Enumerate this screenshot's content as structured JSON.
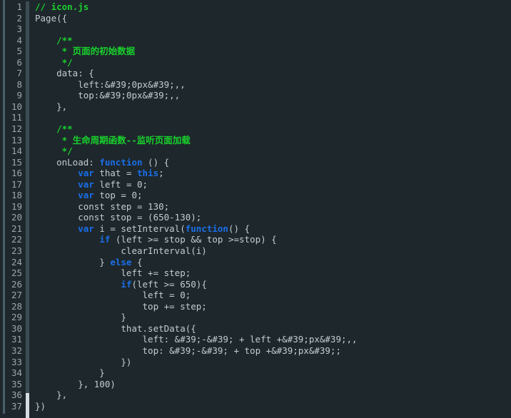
{
  "editor": {
    "language": "javascript",
    "filename": "icon.js",
    "theme": {
      "background": "#1e272c",
      "gutter_background": "#1e272c",
      "line_number_color": "#9aa7ad",
      "default_text": "#c3ccd1",
      "comment": "#19d12c",
      "keyword": "#1a6fe8",
      "string": "#22d3d3",
      "separator": "#3c4c53",
      "separator_highlight": "#d6dde0",
      "rail": "#4a6068"
    },
    "first_line_number": 1,
    "last_line_number": 37,
    "total_lines": 37,
    "lines": [
      {
        "n": "1",
        "tokens": [
          {
            "t": "// icon.js",
            "c": "comment"
          }
        ]
      },
      {
        "n": "2",
        "tokens": [
          {
            "t": "Page({",
            "c": "plain"
          }
        ]
      },
      {
        "n": "3",
        "tokens": [
          {
            "t": "",
            "c": "plain"
          }
        ]
      },
      {
        "n": "4",
        "tokens": [
          {
            "t": "    /**",
            "c": "comment"
          }
        ]
      },
      {
        "n": "5",
        "tokens": [
          {
            "t": "     * 页面的初始数据",
            "c": "comment"
          }
        ]
      },
      {
        "n": "6",
        "tokens": [
          {
            "t": "     */",
            "c": "comment"
          }
        ]
      },
      {
        "n": "7",
        "tokens": [
          {
            "t": "    data: {",
            "c": "plain"
          }
        ]
      },
      {
        "n": "8",
        "tokens": [
          {
            "t": "        left:",
            "c": "plain"
          },
          {
            "t": "&#39;0px&#39;,",
            "c": "string"
          },
          {
            "t": ",",
            "c": "string"
          }
        ]
      },
      {
        "n": "9",
        "tokens": [
          {
            "t": "        top:",
            "c": "plain"
          },
          {
            "t": "&#39;0px&#39;,",
            "c": "string"
          },
          {
            "t": ",",
            "c": "string"
          }
        ]
      },
      {
        "n": "10",
        "tokens": [
          {
            "t": "    },",
            "c": "plain"
          }
        ]
      },
      {
        "n": "11",
        "tokens": [
          {
            "t": "",
            "c": "plain"
          }
        ]
      },
      {
        "n": "12",
        "tokens": [
          {
            "t": "    /**",
            "c": "comment"
          }
        ]
      },
      {
        "n": "13",
        "tokens": [
          {
            "t": "     * 生命周期函数--监听页面加载",
            "c": "comment"
          }
        ]
      },
      {
        "n": "14",
        "tokens": [
          {
            "t": "     */",
            "c": "comment"
          }
        ]
      },
      {
        "n": "15",
        "tokens": [
          {
            "t": "    onLoad: ",
            "c": "plain"
          },
          {
            "t": "function",
            "c": "kw"
          },
          {
            "t": " () {",
            "c": "plain"
          }
        ]
      },
      {
        "n": "16",
        "tokens": [
          {
            "t": "        ",
            "c": "plain"
          },
          {
            "t": "var",
            "c": "kw"
          },
          {
            "t": " that = ",
            "c": "plain"
          },
          {
            "t": "this",
            "c": "kw"
          },
          {
            "t": ";",
            "c": "plain"
          }
        ]
      },
      {
        "n": "17",
        "tokens": [
          {
            "t": "        ",
            "c": "plain"
          },
          {
            "t": "var",
            "c": "kw"
          },
          {
            "t": " left = 0;",
            "c": "plain"
          }
        ]
      },
      {
        "n": "18",
        "tokens": [
          {
            "t": "        ",
            "c": "plain"
          },
          {
            "t": "var",
            "c": "kw"
          },
          {
            "t": " top = 0;",
            "c": "plain"
          }
        ]
      },
      {
        "n": "19",
        "tokens": [
          {
            "t": "        const step = 130;",
            "c": "plain"
          }
        ]
      },
      {
        "n": "20",
        "tokens": [
          {
            "t": "        const stop = (650-130);",
            "c": "plain"
          }
        ]
      },
      {
        "n": "21",
        "tokens": [
          {
            "t": "        ",
            "c": "plain"
          },
          {
            "t": "var",
            "c": "kw"
          },
          {
            "t": " i = setInterval(",
            "c": "plain"
          },
          {
            "t": "function",
            "c": "kw"
          },
          {
            "t": "() {",
            "c": "plain"
          }
        ]
      },
      {
        "n": "22",
        "tokens": [
          {
            "t": "            ",
            "c": "plain"
          },
          {
            "t": "if",
            "c": "kw"
          },
          {
            "t": " (left >= stop && top >=stop) {",
            "c": "plain"
          }
        ]
      },
      {
        "n": "23",
        "tokens": [
          {
            "t": "                clearInterval(i)",
            "c": "plain"
          }
        ]
      },
      {
        "n": "24",
        "tokens": [
          {
            "t": "            } ",
            "c": "plain"
          },
          {
            "t": "else",
            "c": "kw"
          },
          {
            "t": " {",
            "c": "plain"
          }
        ]
      },
      {
        "n": "25",
        "tokens": [
          {
            "t": "                left += step;",
            "c": "plain"
          }
        ]
      },
      {
        "n": "26",
        "tokens": [
          {
            "t": "                ",
            "c": "plain"
          },
          {
            "t": "if",
            "c": "kw"
          },
          {
            "t": "(left >= 650){",
            "c": "plain"
          }
        ]
      },
      {
        "n": "27",
        "tokens": [
          {
            "t": "                    left = 0;",
            "c": "plain"
          }
        ]
      },
      {
        "n": "28",
        "tokens": [
          {
            "t": "                    top += step;",
            "c": "plain"
          }
        ]
      },
      {
        "n": "29",
        "tokens": [
          {
            "t": "                }",
            "c": "plain"
          }
        ]
      },
      {
        "n": "30",
        "tokens": [
          {
            "t": "                that.setData({",
            "c": "plain"
          }
        ]
      },
      {
        "n": "31",
        "tokens": [
          {
            "t": "                    left: ",
            "c": "plain"
          },
          {
            "t": "&#39;-&#39; + left +&#39;px&#39;,",
            "c": "string"
          },
          {
            "t": ",",
            "c": "string"
          }
        ]
      },
      {
        "n": "32",
        "tokens": [
          {
            "t": "                    top: ",
            "c": "plain"
          },
          {
            "t": "&#39;-&#39; + top +&#39;px&#39;",
            "c": "string"
          },
          {
            "t": ";",
            "c": "string"
          }
        ]
      },
      {
        "n": "33",
        "tokens": [
          {
            "t": "                })",
            "c": "plain"
          }
        ]
      },
      {
        "n": "34",
        "tokens": [
          {
            "t": "            }",
            "c": "plain"
          }
        ]
      },
      {
        "n": "35",
        "tokens": [
          {
            "t": "        }, 100)",
            "c": "plain"
          }
        ]
      },
      {
        "n": "36",
        "tokens": [
          {
            "t": "    },",
            "c": "plain"
          }
        ]
      },
      {
        "n": "37",
        "tokens": [
          {
            "t": "})",
            "c": "plain"
          }
        ]
      }
    ]
  }
}
